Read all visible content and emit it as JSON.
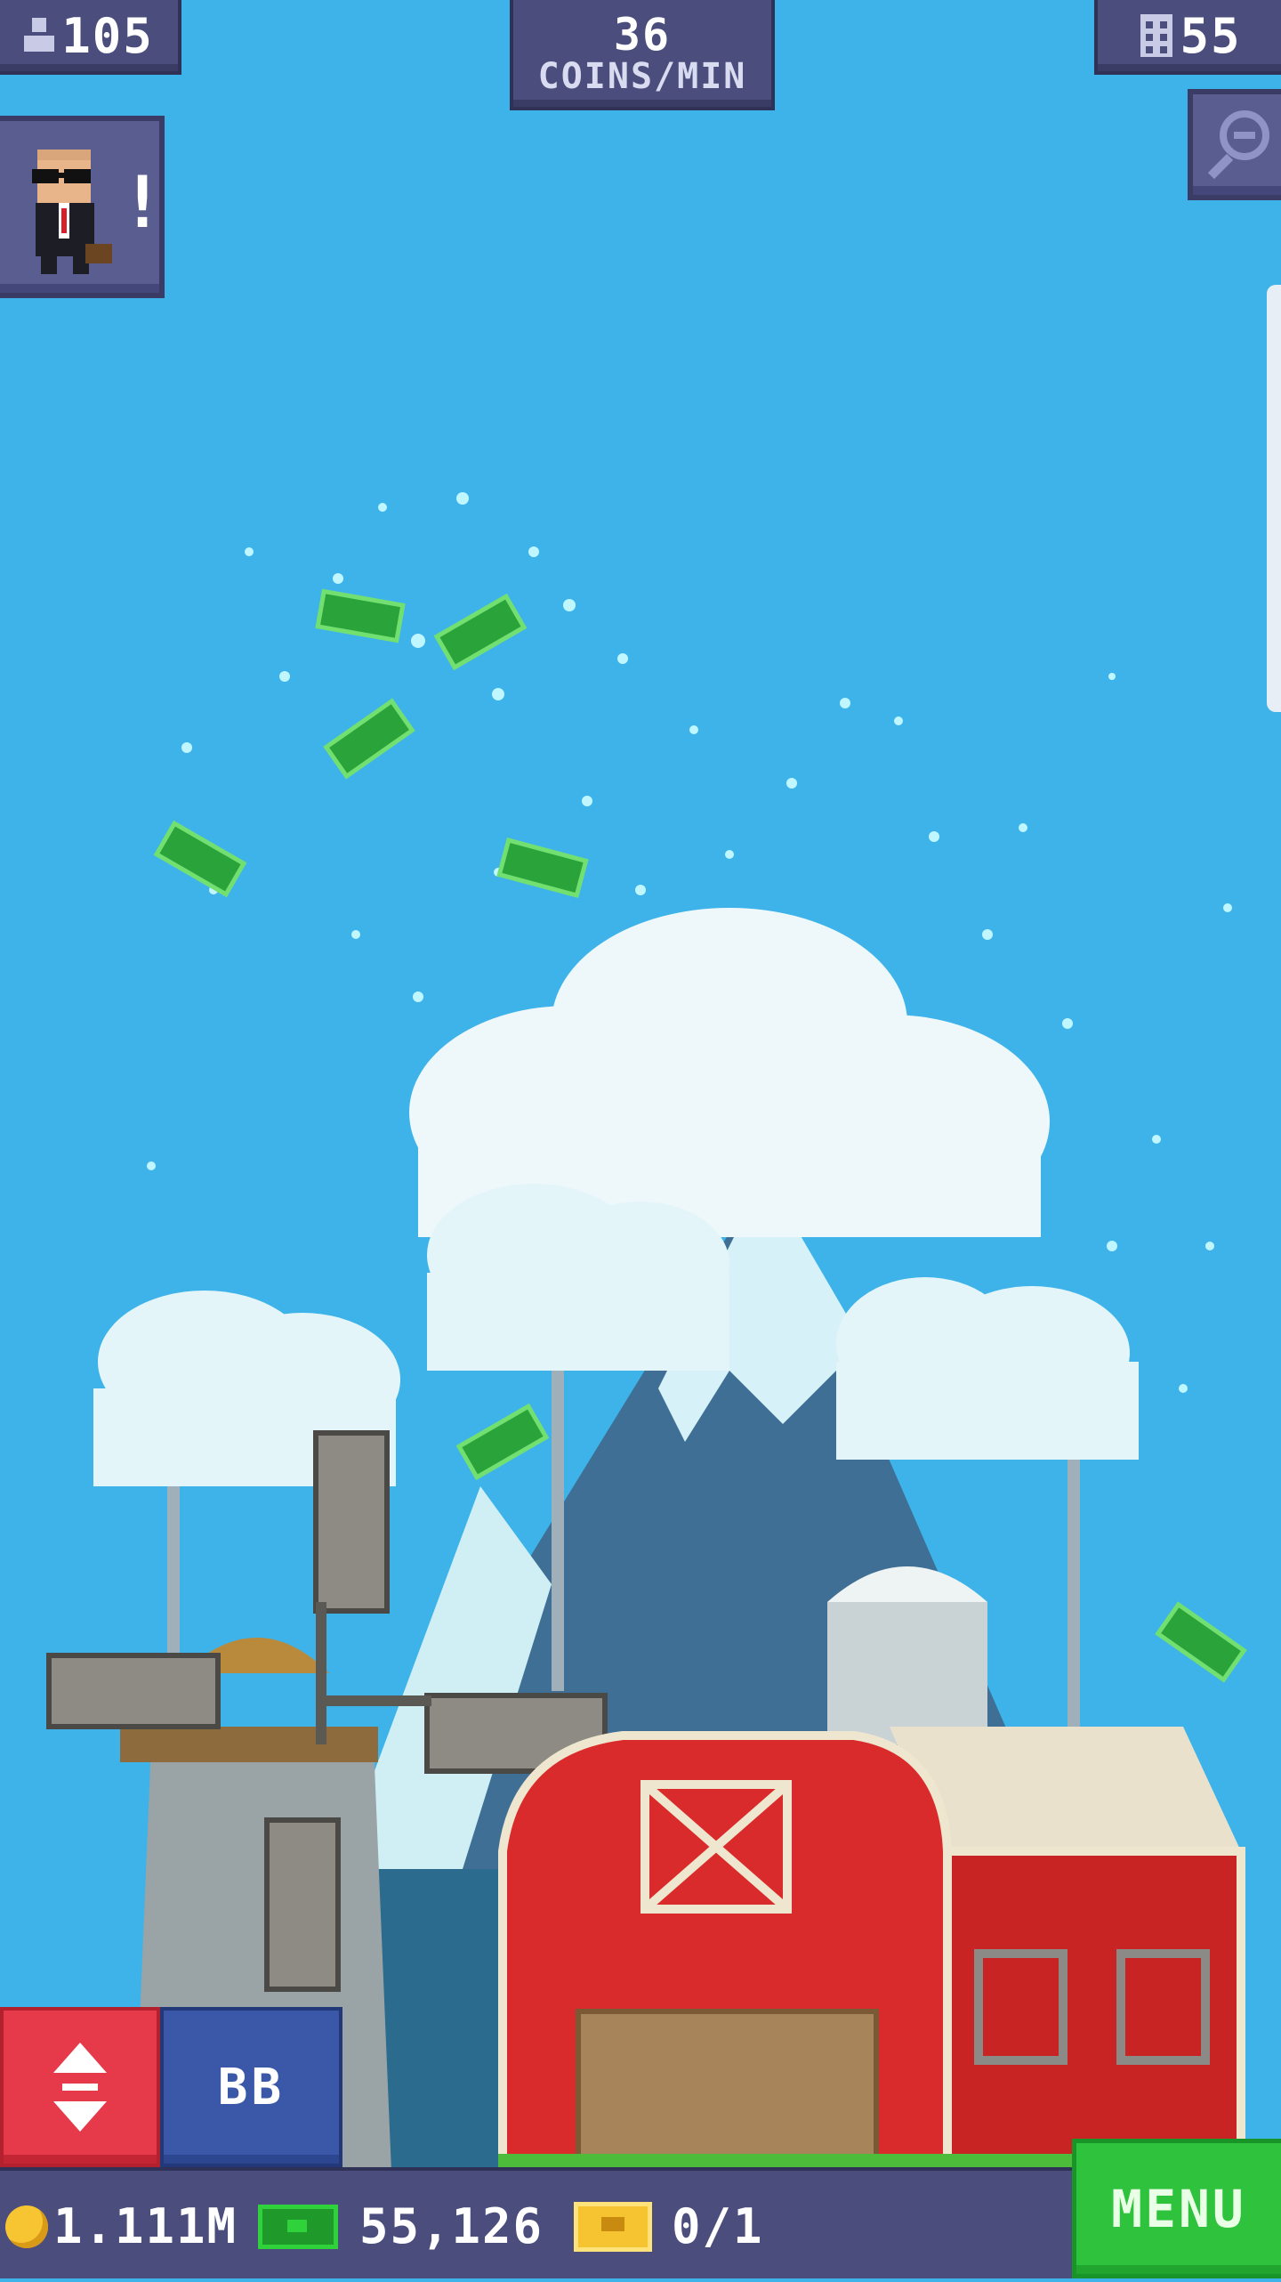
{
  "hud": {
    "population": "105",
    "coins_per_min_value": "36",
    "coins_per_min_unit": "COINS/MIN",
    "floors": "55"
  },
  "buttons": {
    "bb_label": "BB",
    "menu_label": "MENU"
  },
  "alert": "!",
  "currency": {
    "coins": "1.111M",
    "bux": "55,126",
    "tickets": "0/1"
  },
  "colors": {
    "sky": "#3db3ea",
    "hud_panel": "#4b4d7d",
    "menu_green": "#2fc23d",
    "elevator_red": "#e63a4a",
    "bb_blue": "#3b57a8",
    "barn_red": "#d92b2b"
  },
  "icons": [
    "population-icon",
    "floors-icon",
    "zoom-out-icon",
    "elevator-updown-icon",
    "coin-icon",
    "bux-icon",
    "ticket-icon"
  ]
}
